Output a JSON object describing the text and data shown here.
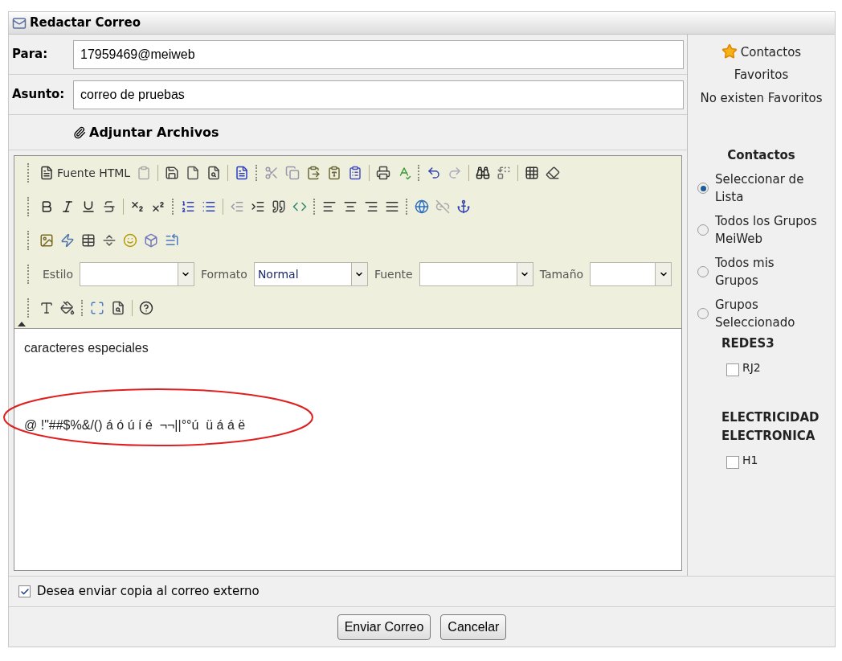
{
  "window": {
    "title": "Redactar Correo"
  },
  "fields": [
    {
      "label": "Para:",
      "value": "17959469@meiweb"
    },
    {
      "label": "Asunto:",
      "value": "correo de pruebas"
    }
  ],
  "attach": {
    "label": "Adjuntar Archivos"
  },
  "editor": {
    "source_button": "Fuente HTML",
    "dropdowns": [
      {
        "label": "Estilo"
      },
      {
        "label": "Formato",
        "value": "Normal"
      },
      {
        "label": "Fuente"
      },
      {
        "label": "Tamaño"
      }
    ],
    "body": [
      "caracteres especiales",
      "@ !\"##$%&/() á ó ú í é  ¬¬||°°ú  ü á á ë"
    ]
  },
  "copy_option": {
    "label": "Desea enviar copia al correo externo",
    "checked": true
  },
  "buttons": [
    "Enviar Correo",
    "Cancelar"
  ],
  "sidebar": {
    "favorites_title": "Contactos Favoritos",
    "favorites_empty": "No existen Favoritos",
    "contacts_title": "Contactos",
    "options": [
      {
        "label": "Seleccionar de Lista",
        "selected": true
      },
      {
        "label": "Todos los Grupos MeiWeb",
        "selected": false
      },
      {
        "label": "Todos mis Grupos",
        "selected": false
      },
      {
        "label": "Grupos Seleccionado",
        "selected": false
      }
    ],
    "groups": [
      {
        "name": "REDES3",
        "members": [
          {
            "label": "RJ2",
            "checked": false
          }
        ]
      },
      {
        "name": "ELECTRICIDAD ELECTRONICA",
        "members": [
          {
            "label": "H1",
            "checked": false
          }
        ]
      }
    ]
  }
}
